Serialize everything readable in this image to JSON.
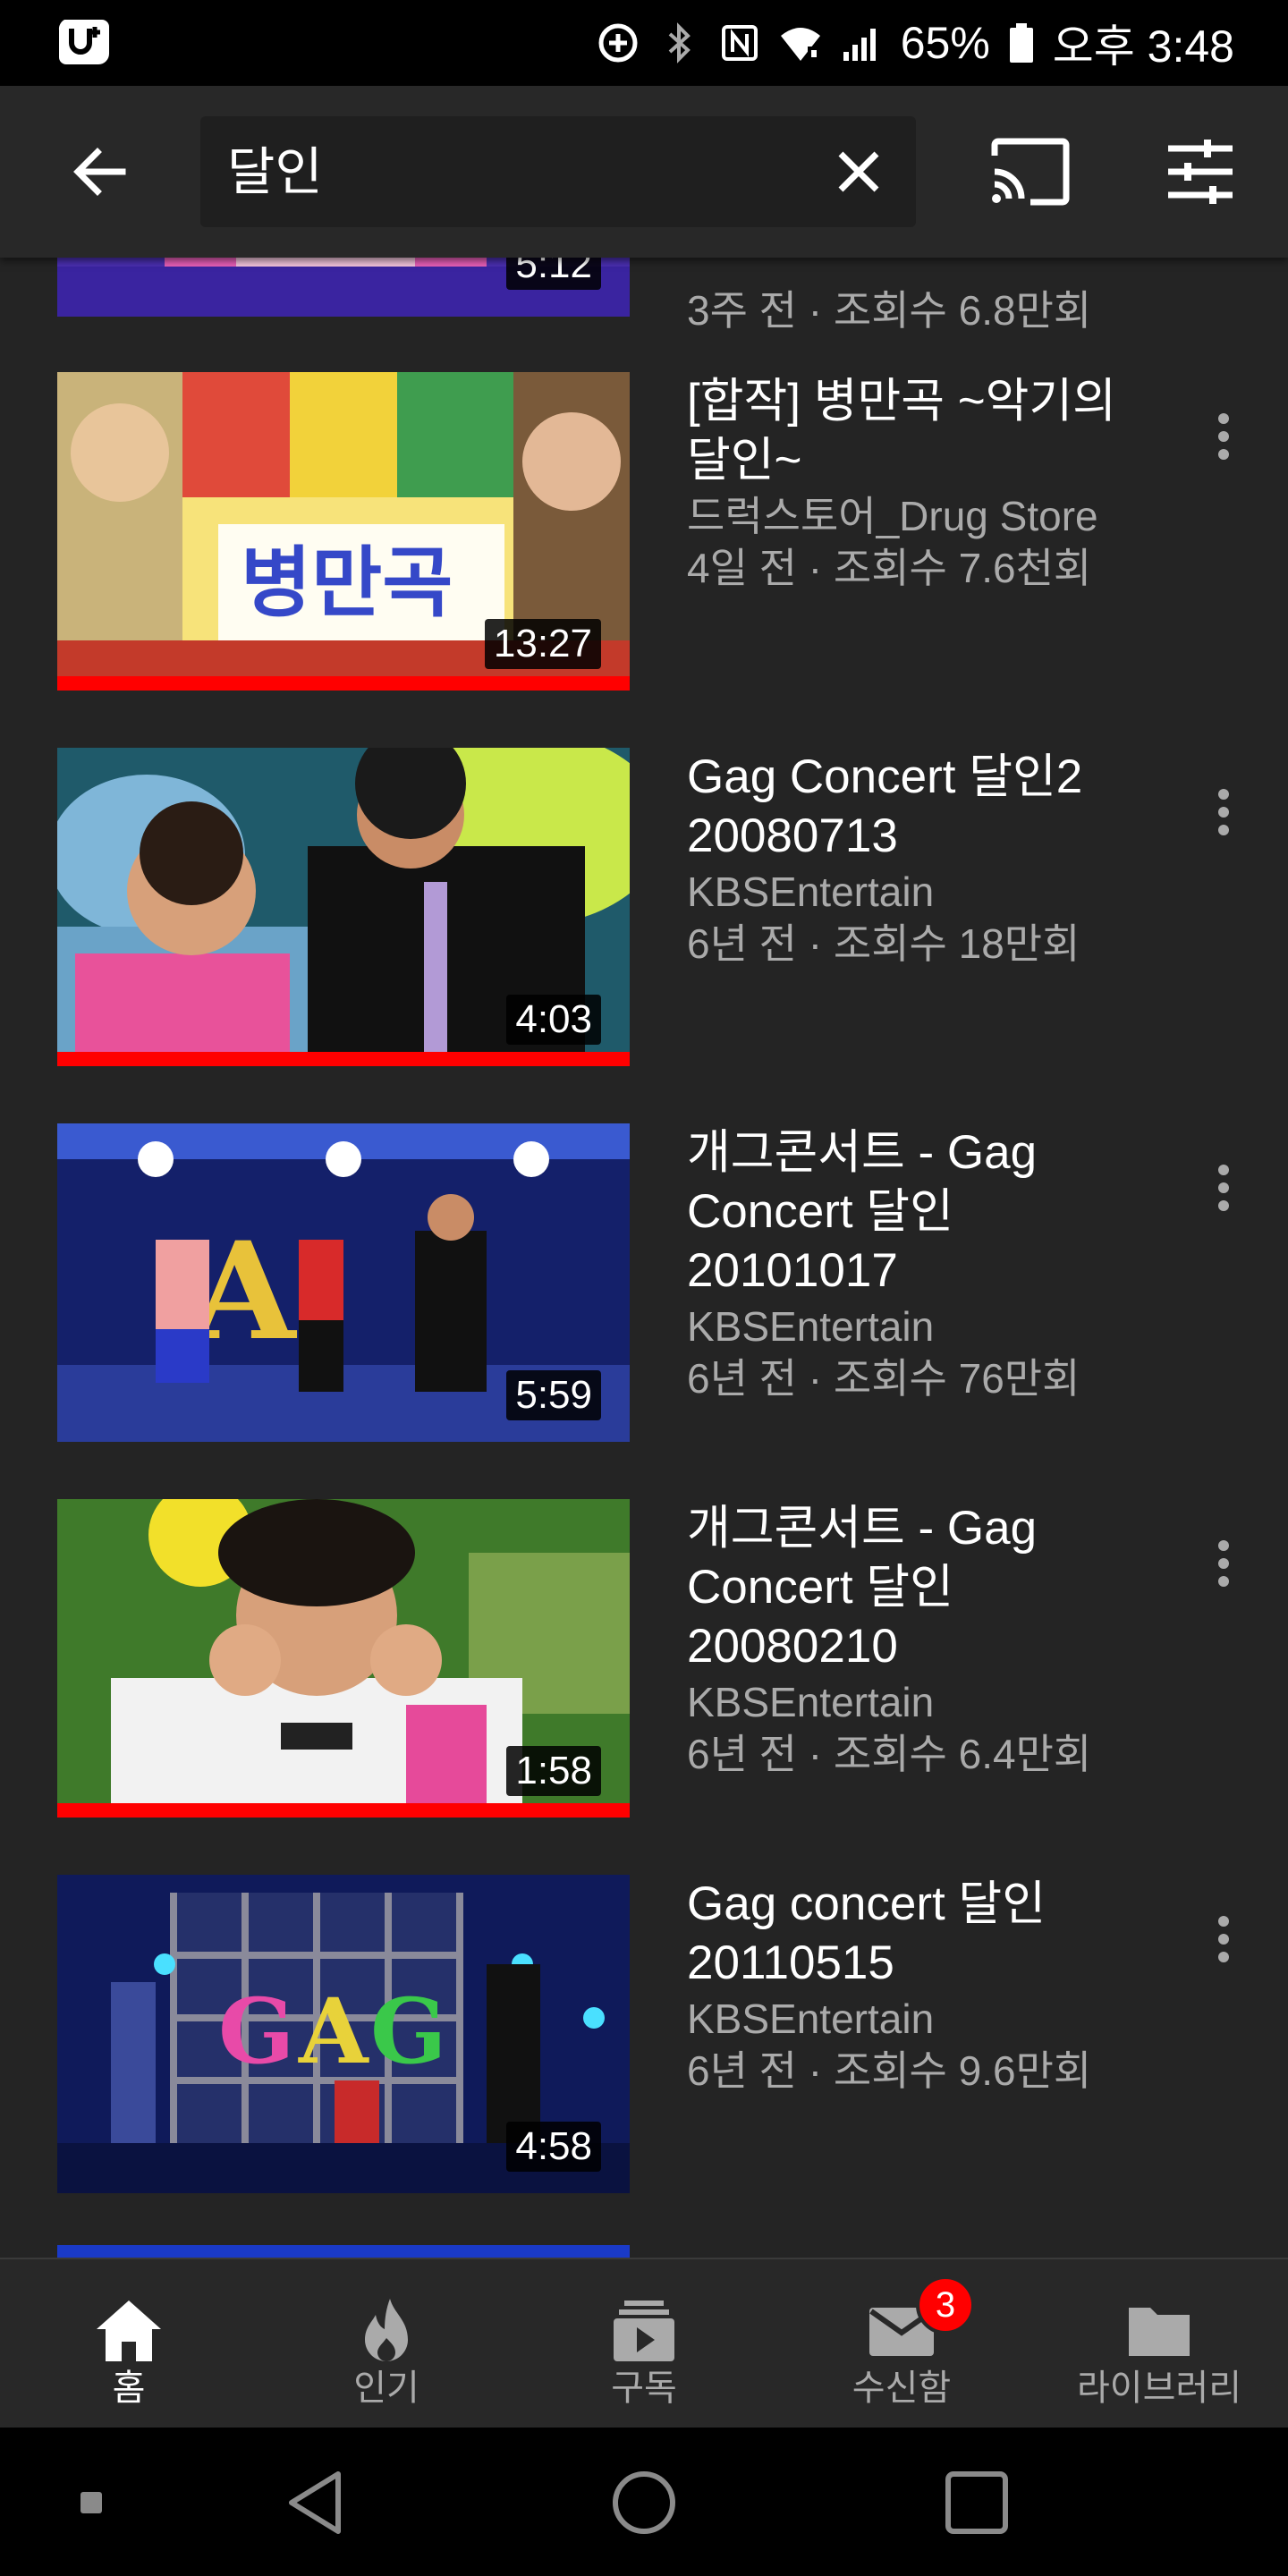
{
  "status_bar": {
    "battery": "65%",
    "time": "오후 3:48"
  },
  "app_bar": {
    "search_query": "달인",
    "icons": [
      "back-arrow-icon",
      "clear-icon",
      "cast-icon",
      "filter-icon"
    ]
  },
  "partial_top_item": {
    "duration": "5:12",
    "meta": "3주 전 · 조회수 6.8만회"
  },
  "videos": [
    {
      "title": "[합작] 병만곡 ~악기의 달인~",
      "channel": "드럭스토어_Drug Store",
      "meta": "4일 전 · 조회수 7.6천회",
      "duration": "13:27",
      "watched": true
    },
    {
      "title": "Gag Concert 달인2 20080713",
      "channel": "KBSEntertain",
      "meta": "6년 전 · 조회수 18만회",
      "duration": "4:03",
      "watched": true
    },
    {
      "title": "개그콘서트 - Gag Concert 달인 20101017",
      "channel": "KBSEntertain",
      "meta": "6년 전 · 조회수 76만회",
      "duration": "5:59",
      "watched": false
    },
    {
      "title": "개그콘서트 - Gag Concert 달인 20080210",
      "channel": "KBSEntertain",
      "meta": "6년 전 · 조회수 6.4만회",
      "duration": "1:58",
      "watched": true
    },
    {
      "title": "Gag concert 달인 20110515",
      "channel": "KBSEntertain",
      "meta": "6년 전 · 조회수 9.6만회",
      "duration": "4:58",
      "watched": false
    }
  ],
  "bottom_nav": {
    "items": [
      {
        "label": "홈",
        "icon": "home-icon",
        "active": true
      },
      {
        "label": "인기",
        "icon": "trending-flame-icon",
        "active": false
      },
      {
        "label": "구독",
        "icon": "subscriptions-icon",
        "active": false
      },
      {
        "label": "수신함",
        "icon": "inbox-mail-icon",
        "active": false
      },
      {
        "label": "라이브러리",
        "icon": "library-folder-icon",
        "active": false
      }
    ],
    "inbox_badge": "3"
  },
  "system_nav": {
    "icons": [
      "recents-dot-icon",
      "back-triangle-icon",
      "home-circle-icon",
      "overview-square-icon"
    ]
  },
  "colors": {
    "background": "#242424",
    "app_bar": "#282828",
    "accent_red": "#ff0000",
    "secondary_text": "#aaaaaa"
  }
}
